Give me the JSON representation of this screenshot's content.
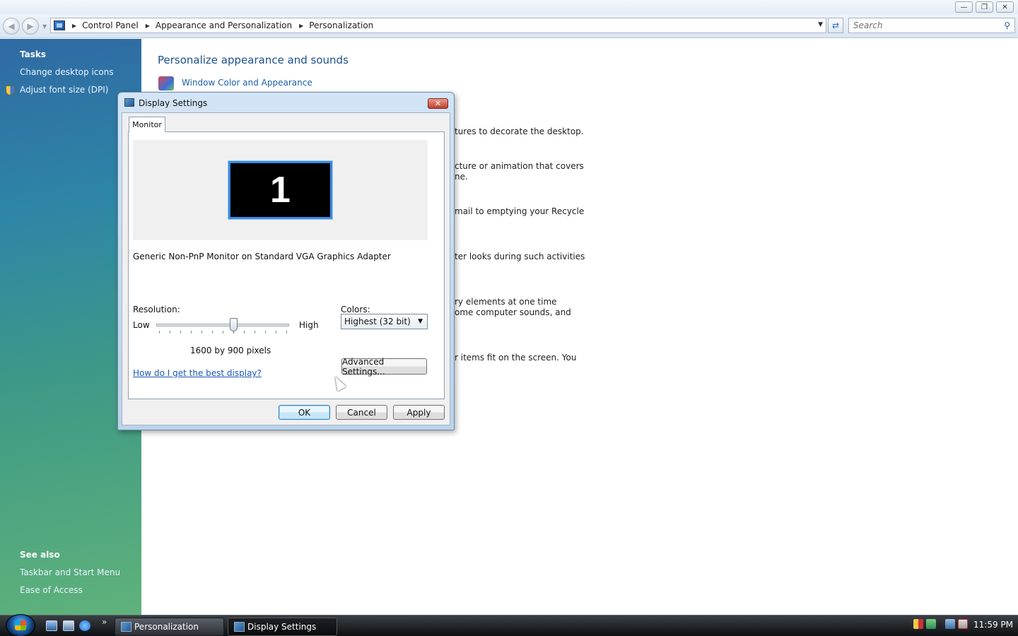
{
  "explorer": {
    "address": {
      "crumbs": [
        "Control Panel",
        "Appearance and Personalization",
        "Personalization"
      ]
    },
    "search": {
      "placeholder": "Search"
    }
  },
  "taskpane": {
    "tasks_heading": "Tasks",
    "tasks": [
      "Change desktop icons",
      "Adjust font size (DPI)"
    ],
    "see_also_heading": "See also",
    "see_also": [
      "Taskbar and Start Menu",
      "Ease of Access"
    ]
  },
  "main": {
    "title": "Personalize appearance and sounds",
    "window_color_link": "Window Color and Appearance",
    "peek_lines": [
      "tures to decorate the desktop.",
      "cture or animation that covers",
      "ne.",
      "mail to emptying your Recycle",
      "ter looks during such activities",
      "ry elements at one time",
      "ome computer sounds, and",
      "r items fit on the screen. You"
    ]
  },
  "dialog": {
    "title": "Display Settings",
    "tab": "Monitor",
    "monitor_number": "1",
    "monitor_description": "Generic Non-PnP Monitor on Standard VGA Graphics Adapter",
    "resolution_label": "Resolution:",
    "low": "Low",
    "high": "High",
    "resolution_value": "1600 by 900 pixels",
    "colors_label": "Colors:",
    "colors_value": "Highest (32 bit)",
    "help_link": "How do I get the best display?",
    "advanced_button": "Advanced Settings...",
    "ok": "OK",
    "cancel": "Cancel",
    "apply": "Apply"
  },
  "taskbar": {
    "windows": [
      "Personalization",
      "Display Settings"
    ],
    "clock": "11:59 PM"
  }
}
